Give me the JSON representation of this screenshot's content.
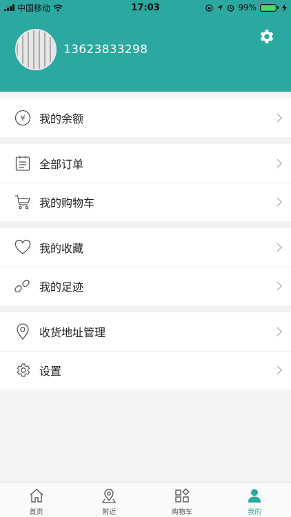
{
  "status_bar": {
    "carrier": "中国移动",
    "time": "17:03",
    "battery_percent": "99%",
    "battery_level": 0.99
  },
  "profile": {
    "phone": "13623833298"
  },
  "menu": {
    "balance": "我的余额",
    "orders": "全部订单",
    "cart": "我的购物车",
    "favorites": "我的收藏",
    "footprints": "我的足迹",
    "address": "收货地址管理",
    "settings": "设置"
  },
  "tabs": [
    {
      "label": "首页",
      "icon": "home-icon"
    },
    {
      "label": "附近",
      "icon": "location-pin-icon"
    },
    {
      "label": "购物车",
      "icon": "category-grid-icon"
    },
    {
      "label": "我的",
      "icon": "user-icon"
    }
  ],
  "active_tab": 3,
  "colors": {
    "primary": "#2ba89f",
    "background": "#f3f3f3",
    "text": "#222222"
  }
}
